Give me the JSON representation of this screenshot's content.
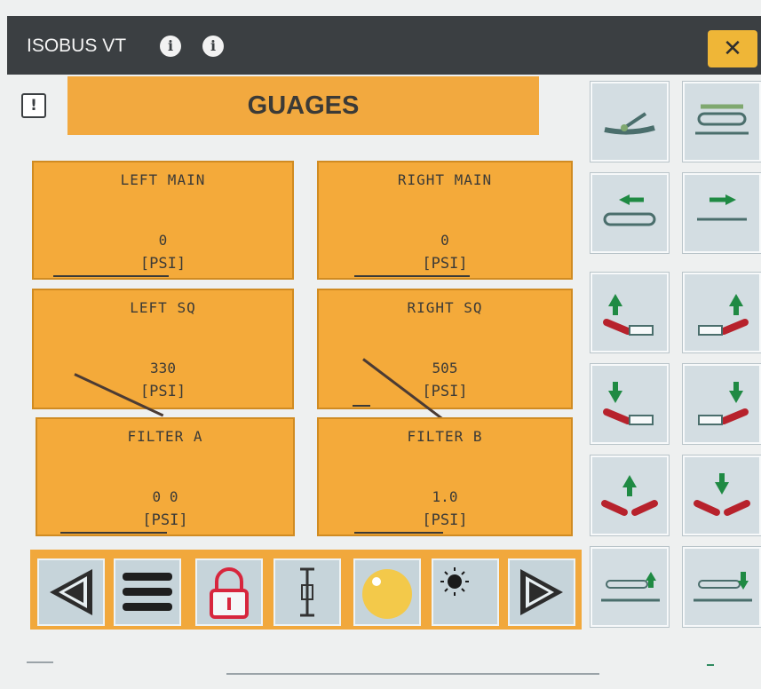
{
  "window": {
    "title": "ISOBUS VT",
    "info_icons": [
      "info-icon",
      "info-icon"
    ],
    "close_symbol": "✕"
  },
  "alarm_symbol": "!",
  "page": {
    "title": "GUAGES"
  },
  "gauges": [
    {
      "label": "LEFT MAIN",
      "value": "0",
      "unit": "[PSI]"
    },
    {
      "label": "RIGHT MAIN",
      "value": "0",
      "unit": "[PSI]"
    },
    {
      "label": "LEFT SQ",
      "value": "330",
      "unit": "[PSI]"
    },
    {
      "label": "RIGHT SQ",
      "value": "505",
      "unit": "[PSI]"
    },
    {
      "label": "FILTER A",
      "value": "0 0",
      "unit": "[PSI]"
    },
    {
      "label": "FILTER B",
      "value": "1.0",
      "unit": "[PSI]"
    }
  ],
  "right_buttons": [
    "sprayer-boom-fold-icon",
    "boom-level-icon",
    "boom-extend-left-icon",
    "boom-extend-right-icon",
    "left-wing-raise-icon",
    "right-wing-raise-icon",
    "left-wing-lower-icon",
    "right-wing-lower-icon",
    "both-wings-raise-icon",
    "both-wings-lower-icon",
    "boom-tilt-left-icon",
    "boom-tilt-right-icon"
  ],
  "bottom_buttons": [
    "previous-icon",
    "menu-icon",
    "lock-icon",
    "boom-height-icon",
    "night-mode-icon",
    "day-mode-icon",
    "next-icon"
  ],
  "colors": {
    "accent": "#f2a93f",
    "titlebar": "#3b3f42",
    "close": "#efb637",
    "button": "#d3dde2",
    "arrow_green": "#1f8a43",
    "wing_red": "#b7222c"
  }
}
